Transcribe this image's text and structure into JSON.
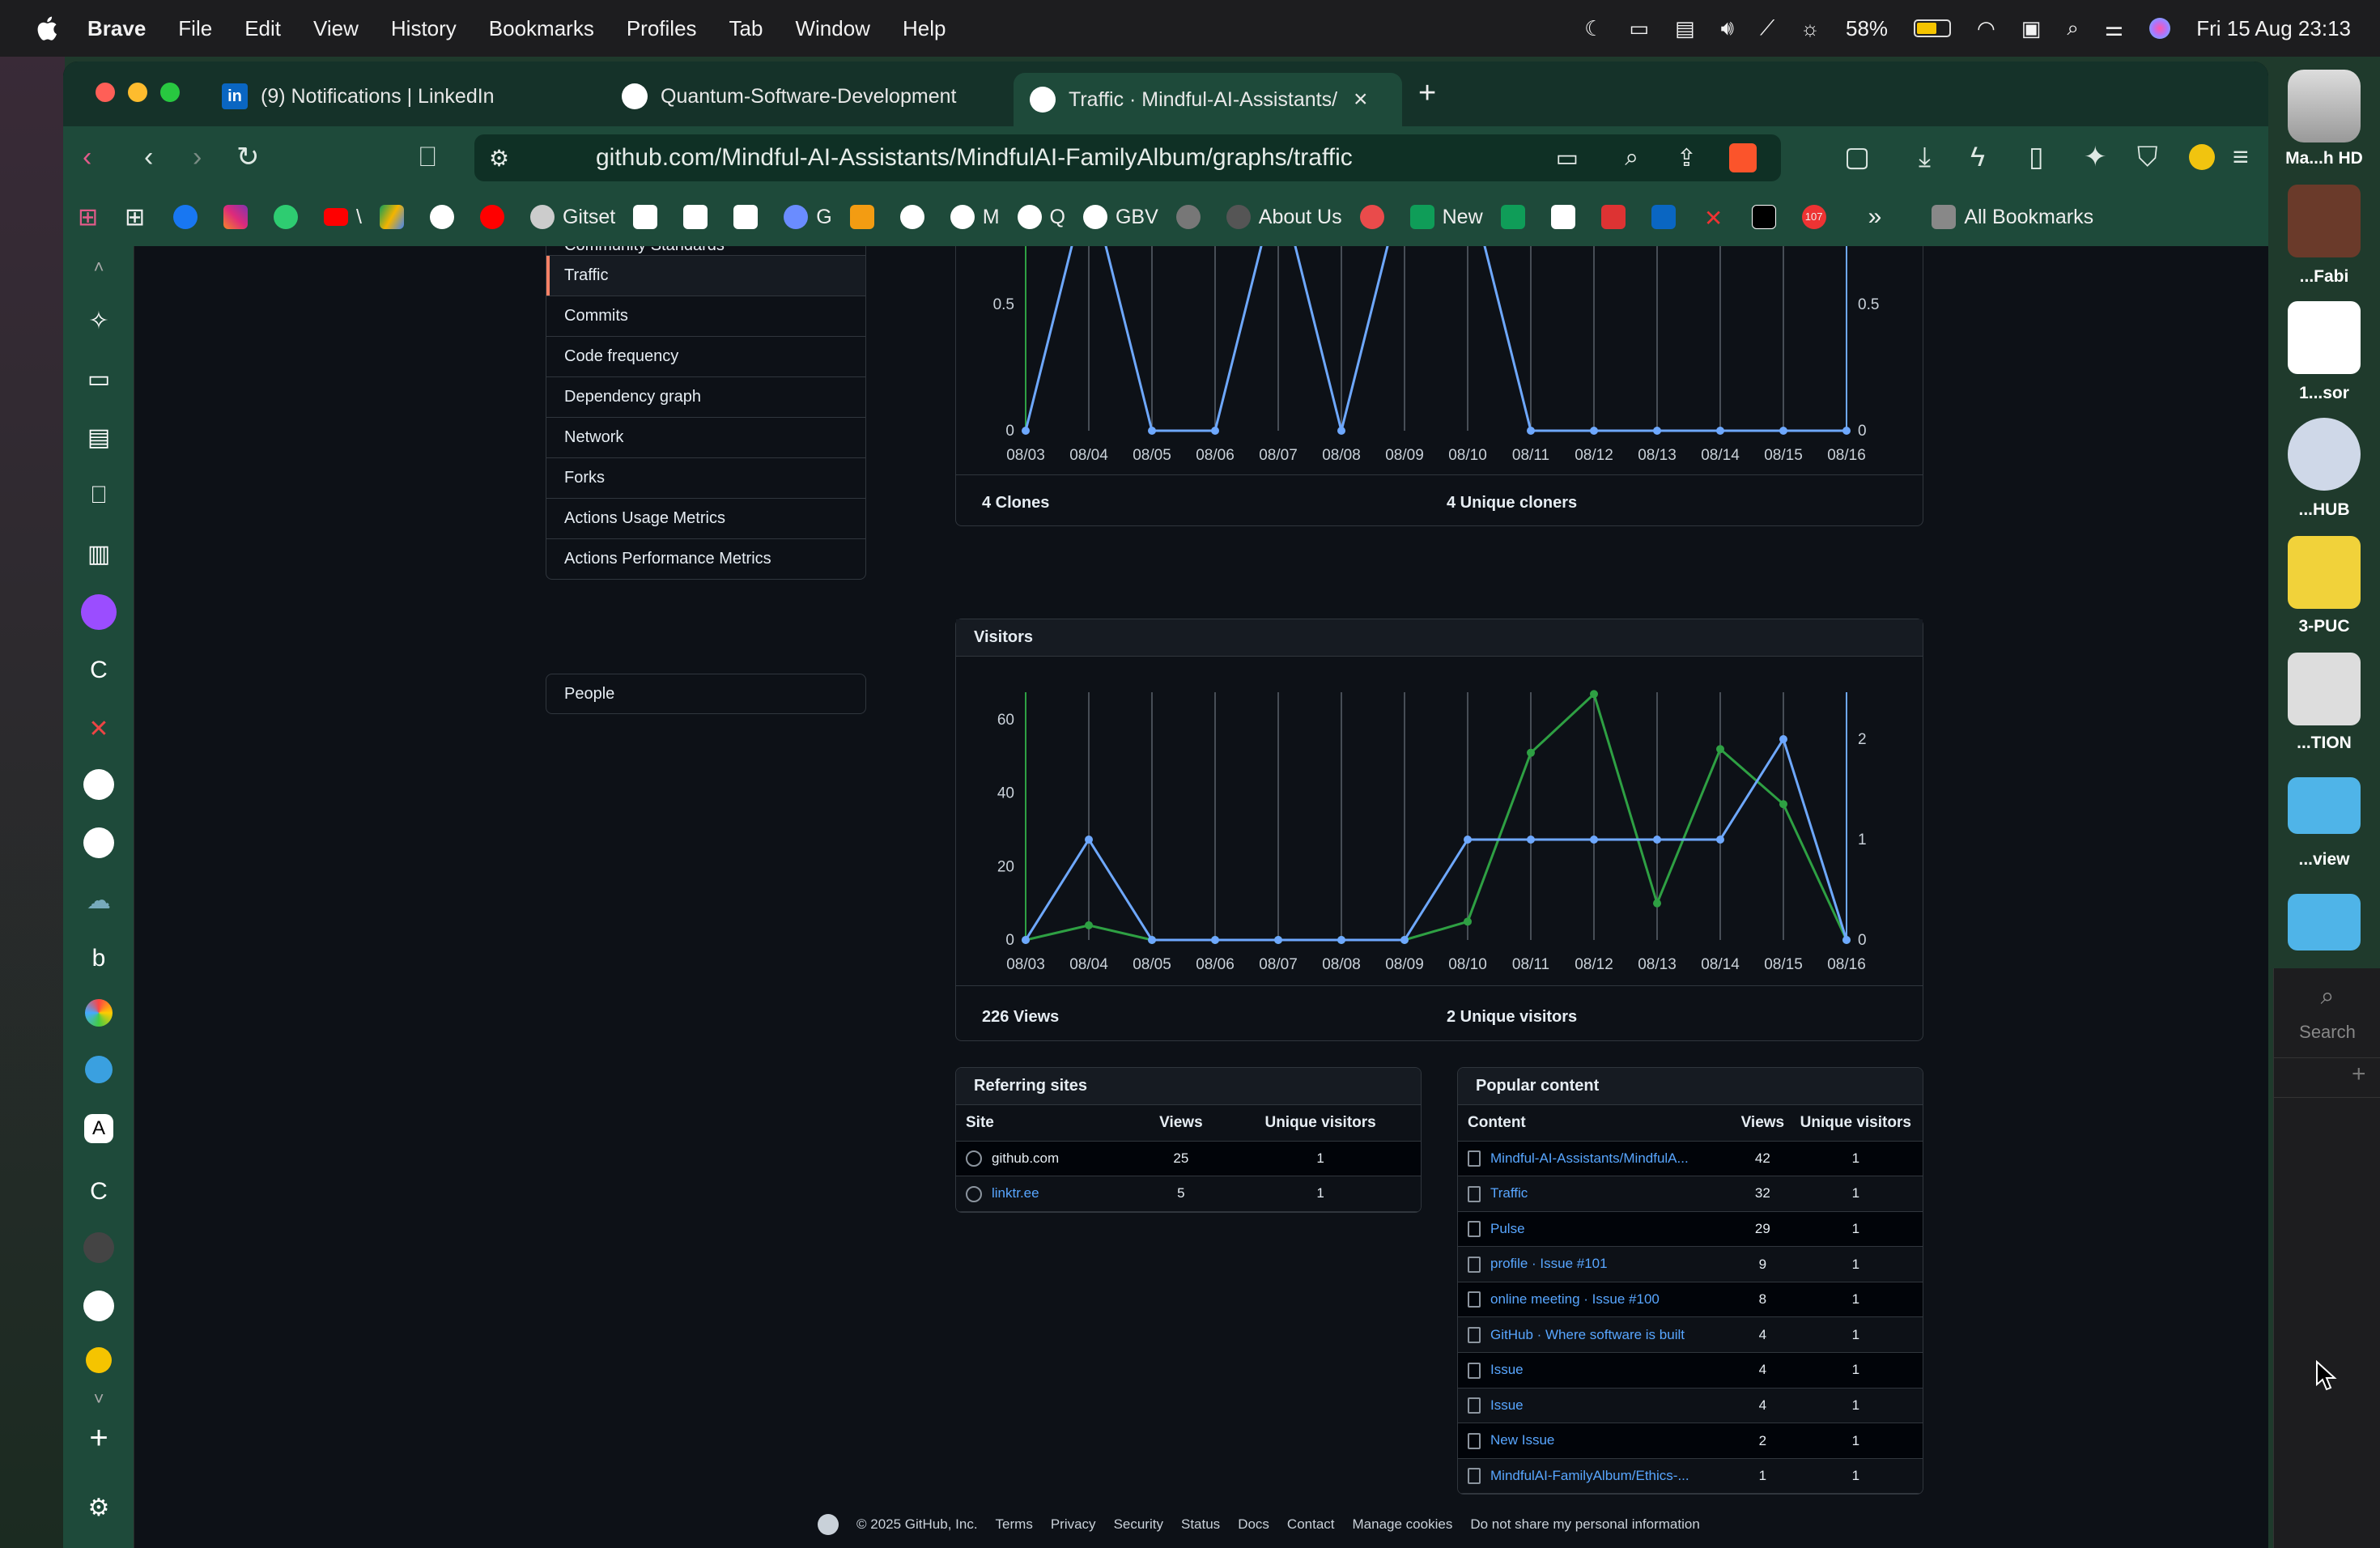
{
  "menubar": {
    "app": "Brave",
    "items": [
      "File",
      "Edit",
      "View",
      "History",
      "Bookmarks",
      "Profiles",
      "Tab",
      "Window",
      "Help"
    ],
    "battery": "58%",
    "datetime": "Fri 15 Aug  23:13"
  },
  "tabs": [
    {
      "label": "(9) Notifications | LinkedIn"
    },
    {
      "label": "Quantum-Software-Development"
    },
    {
      "label": "Traffic · Mindful-AI-Assistants/"
    }
  ],
  "address": {
    "url": "github.com/Mindful-AI-Assistants/MindfulAI-FamilyAlbum/graphs/traffic"
  },
  "bookmarks": {
    "gitset": "Gitset",
    "g": "G",
    "m": "M",
    "q": "Q",
    "gbv": "GBV",
    "about": "About Us",
    "new": "New",
    "more": "»",
    "all": "All Bookmarks",
    "badge": "107"
  },
  "sidenav": {
    "items": [
      "Community Standards",
      "Traffic",
      "Commits",
      "Code frequency",
      "Dependency graph",
      "Network",
      "Forks",
      "Actions Usage Metrics",
      "Actions Performance Metrics"
    ],
    "people": "People"
  },
  "clones": {
    "dates": [
      "08/03",
      "08/04",
      "08/05",
      "08/06",
      "08/07",
      "08/08",
      "08/09",
      "08/10",
      "08/11",
      "08/12",
      "08/13",
      "08/14",
      "08/15",
      "08/16"
    ],
    "left_ticks": [
      "0.5",
      "0"
    ],
    "right_ticks": [
      "0.5",
      "0"
    ],
    "total_label": "4 Clones",
    "unique_label": "4 Unique cloners"
  },
  "visitors": {
    "title": "Visitors",
    "left_ticks": [
      "60",
      "40",
      "20",
      "0"
    ],
    "right_ticks": [
      "2",
      "1",
      "0"
    ],
    "total_label": "226 Views",
    "unique_label": "2 Unique visitors"
  },
  "chart_data": [
    {
      "type": "line",
      "title": "",
      "x": [
        "08/03",
        "08/04",
        "08/05",
        "08/06",
        "08/07",
        "08/08",
        "08/09",
        "08/10",
        "08/11",
        "08/12",
        "08/13",
        "08/14",
        "08/15",
        "08/16"
      ],
      "ylim": [
        0,
        1
      ],
      "series": [
        {
          "name": "",
          "values": [
            0,
            1,
            0,
            0,
            1,
            0,
            1,
            1,
            0,
            0,
            0,
            0,
            0,
            0
          ]
        }
      ],
      "grid": true
    },
    {
      "type": "line",
      "title": "Visitors",
      "x": [
        "08/03",
        "08/04",
        "08/05",
        "08/06",
        "08/07",
        "08/08",
        "08/09",
        "08/10",
        "08/11",
        "08/12",
        "08/13",
        "08/14",
        "08/15",
        "08/16"
      ],
      "ylim": [
        0,
        67
      ],
      "y2lim": [
        0,
        2.5
      ],
      "series": [
        {
          "name": "",
          "axis": "left",
          "color": "#2ea043",
          "values": [
            0,
            4,
            0,
            0,
            0,
            0,
            0,
            5,
            51,
            67,
            10,
            52,
            37,
            0
          ]
        },
        {
          "name": "",
          "axis": "right",
          "color": "#6ea8fe",
          "values": [
            0,
            1,
            0,
            0,
            0,
            0,
            0,
            1,
            1,
            1,
            1,
            1,
            2,
            0
          ]
        }
      ],
      "grid": true
    }
  ],
  "referring": {
    "title": "Referring sites",
    "headers": [
      "Site",
      "Views",
      "Unique visitors"
    ],
    "rows": [
      {
        "site": "github.com",
        "views": "25",
        "unique": "1"
      },
      {
        "site": "linktr.ee",
        "views": "5",
        "unique": "1"
      }
    ]
  },
  "popular": {
    "title": "Popular content",
    "headers": [
      "Content",
      "Views",
      "Unique visitors"
    ],
    "rows": [
      {
        "content": "Mindful-AI-Assistants/MindfulA...",
        "views": "42",
        "unique": "1"
      },
      {
        "content": "Traffic",
        "views": "32",
        "unique": "1"
      },
      {
        "content": "Pulse",
        "views": "29",
        "unique": "1"
      },
      {
        "content": "profile · Issue #101",
        "views": "9",
        "unique": "1"
      },
      {
        "content": "online meeting · Issue #100",
        "views": "8",
        "unique": "1"
      },
      {
        "content": "GitHub · Where software is built",
        "views": "4",
        "unique": "1"
      },
      {
        "content": "Issue",
        "views": "4",
        "unique": "1"
      },
      {
        "content": "Issue",
        "views": "4",
        "unique": "1"
      },
      {
        "content": "New Issue",
        "views": "2",
        "unique": "1"
      },
      {
        "content": "MindfulAI-FamilyAlbum/Ethics-...",
        "views": "1",
        "unique": "1"
      }
    ]
  },
  "footer": {
    "items": [
      "© 2025 GitHub, Inc.",
      "Terms",
      "Privacy",
      "Security",
      "Status",
      "Docs",
      "Contact",
      "Manage cookies",
      "Do not share my personal information"
    ]
  },
  "dock": {
    "labels": [
      "Ma...h HD",
      "...Fabi",
      "1...sor",
      "...HUB",
      "3-PUC",
      "...TION",
      "...view"
    ],
    "search": "Search"
  },
  "colors": {
    "accent": "#f78166",
    "link": "#58a6ff",
    "green": "#2ea043",
    "blue": "#6ea8fe"
  }
}
